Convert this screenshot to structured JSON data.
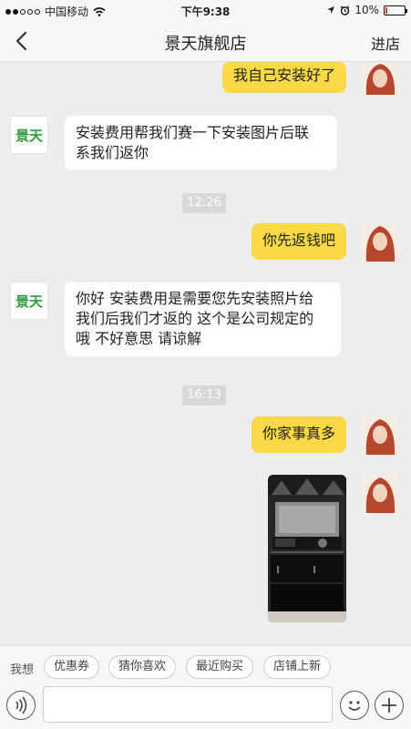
{
  "status_bar": {
    "carrier": "中国移动",
    "time": "下午9:38",
    "battery_percent": "10%",
    "battery_level": 0.1
  },
  "navbar": {
    "title": "景天旗舰店",
    "right_action": "进店"
  },
  "shop": {
    "logo_text": "景天"
  },
  "messages": [
    {
      "from": "me",
      "text": "我自己安装好了"
    },
    {
      "from": "shop",
      "text_lines": [
        "安装费用帮我们赛一下安装图片后联",
        "系我们返你"
      ]
    },
    {
      "type": "time",
      "text": "12:26"
    },
    {
      "from": "me",
      "text": "你先返钱吧"
    },
    {
      "from": "shop",
      "text_lines": [
        "你好 安装费用是需要您先安装照片给",
        "我们后我们才返的 这个是公司规定的",
        "哦  不好意思 请谅解"
      ]
    },
    {
      "type": "time",
      "text": "16:13"
    },
    {
      "from": "me",
      "text": "你家事真多"
    },
    {
      "from": "me",
      "type": "image"
    }
  ],
  "quick_bar": {
    "label": "我想",
    "chips": [
      "优惠券",
      "猜你喜欢",
      "最近购买",
      "店铺上新"
    ]
  },
  "input": {
    "value": "",
    "placeholder": ""
  },
  "colors": {
    "my_bubble": "#fdd948",
    "their_bubble": "#ffffff",
    "background": "#ededed",
    "logo_green": "#2f9b3f"
  },
  "icons": [
    "back-icon",
    "wifi-icon",
    "location-icon",
    "alarm-icon",
    "voice-icon",
    "emoji-icon",
    "plus-icon"
  ]
}
